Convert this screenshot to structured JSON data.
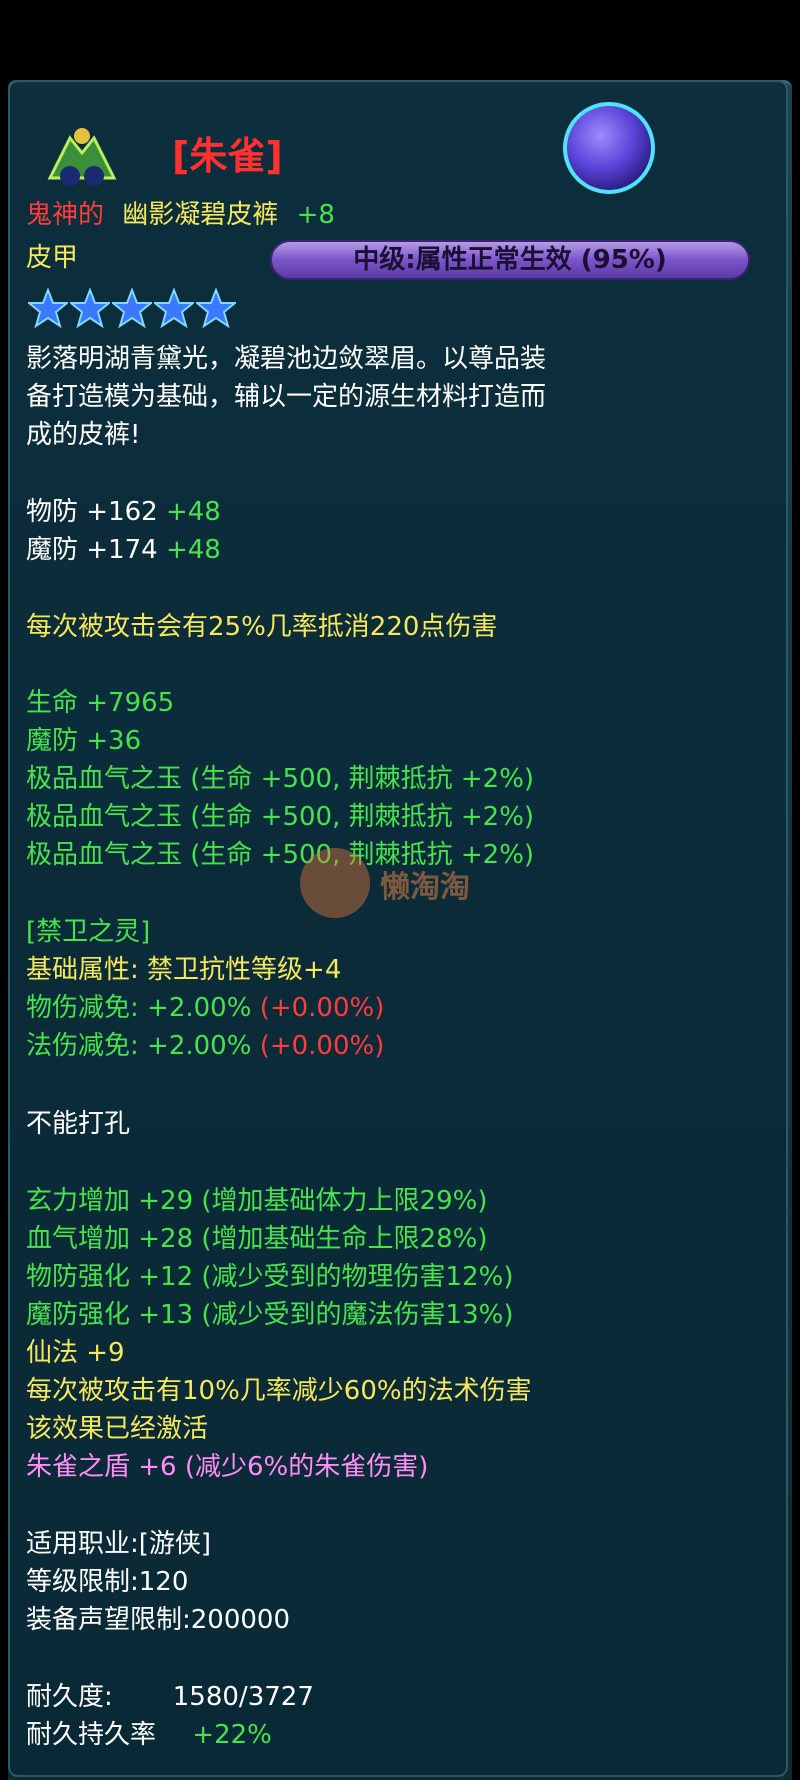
{
  "item": {
    "name_tag": "[朱雀]",
    "prefix": "鬼神的",
    "title": "幽影凝碧皮裤",
    "enhance": "+8",
    "type": "皮甲",
    "status_label": "中级:属性正常生效 (95%)",
    "stars": 5,
    "description_lines": [
      "影落明湖青黛光，凝碧池边敛翠眉。以尊品装",
      "备打造模为基础，辅以一定的源生材料打造而",
      "成的皮裤!"
    ]
  },
  "defense": [
    {
      "label": "物防",
      "base": "+162",
      "bonus": "+48"
    },
    {
      "label": "魔防",
      "base": "+174",
      "bonus": "+48"
    }
  ],
  "special_effect": "每次被攻击会有25%几率抵消220点伤害",
  "attributes": [
    "生命 +7965",
    "魔防 +36",
    "极品血气之玉 (生命 +500, 荆棘抵抗 +2%)",
    "极品血气之玉 (生命 +500, 荆棘抵抗 +2%)",
    "极品血气之玉 (生命 +500, 荆棘抵抗 +2%)"
  ],
  "guard_spirit": {
    "title": "[禁卫之灵]",
    "base_label": "基础属性:",
    "base_value": "禁卫抗性等级+4",
    "lines": [
      {
        "label": "物伤减免:",
        "value": "+2.00%",
        "extra": "(+0.00%)"
      },
      {
        "label": "法伤减免:",
        "value": "+2.00%",
        "extra": "(+0.00%)"
      }
    ]
  },
  "socket": "不能打孔",
  "refine": [
    "玄力增加 +29 (增加基础体力上限29%)",
    "血气增加 +28 (增加基础生命上限28%)",
    "物防强化 +12 (减少受到的物理伤害12%)",
    "魔防强化 +13 (减少受到的魔法伤害13%)"
  ],
  "magic": {
    "line1": "仙法 +9",
    "line2": "每次被攻击有10%几率减少60%的法术伤害",
    "line3": "该效果已经激活"
  },
  "suzaku": "朱雀之盾 +6 (减少6%的朱雀伤害)",
  "requirements": {
    "class": "适用职业:[游侠]",
    "level": "等级限制:120",
    "prestige": "装备声望限制:200000"
  },
  "durability": {
    "label": "耐久度:",
    "value": "1580/3727",
    "rate_label": "耐久持久率",
    "rate_value": "+22%"
  },
  "watermark": "懒淘淘",
  "colors": {
    "white": "#ffffff",
    "green": "#47e34c",
    "yellow": "#f6e85a",
    "red": "#ff3b3b",
    "pink": "#ff8cf7"
  }
}
